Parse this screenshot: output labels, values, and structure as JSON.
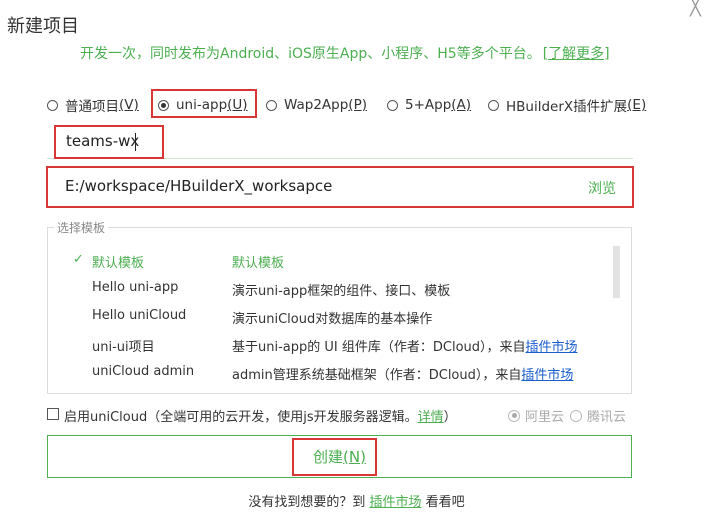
{
  "dialog": {
    "title": "新建项目",
    "close_glyph": "╳"
  },
  "subtitle": {
    "text": "开发一次，同时发布为Android、iOS原生App、小程序、H5等多个平台。",
    "link": "[了解更多]"
  },
  "project_types": [
    {
      "label": "普通项目",
      "hotkey": "(V)",
      "selected": false
    },
    {
      "label": "uni-app",
      "hotkey": "(U)",
      "selected": true
    },
    {
      "label": "Wap2App",
      "hotkey": "(P)",
      "selected": false
    },
    {
      "label": "5+App",
      "hotkey": "(A)",
      "selected": false
    },
    {
      "label": "HBuilderX插件扩展",
      "hotkey": "(E)",
      "selected": false
    }
  ],
  "project_name": {
    "value": "teams-wx"
  },
  "project_path": {
    "value": "E:/workspace/HBuilderX_worksapce",
    "browse_label": "浏览"
  },
  "templates": {
    "legend": "选择模板",
    "rows": [
      {
        "name": "默认模板",
        "desc": "默认模板",
        "link": "",
        "selected": true
      },
      {
        "name": "Hello uni-app",
        "desc": "演示uni-app框架的组件、接口、模板",
        "link": "",
        "selected": false
      },
      {
        "name": "Hello uniCloud",
        "desc": "演示uniCloud对数据库的基本操作",
        "link": "",
        "selected": false
      },
      {
        "name": "uni-ui项目",
        "desc": "基于uni-app的 UI 组件库（作者：DCloud），来自",
        "link": "插件市场",
        "selected": false
      },
      {
        "name": "uniCloud admin",
        "desc": "admin管理系统基础框架（作者：DCloud），来自",
        "link": "插件市场",
        "selected": false
      }
    ]
  },
  "unicloud": {
    "label": "启用uniCloud（全端可用的云开发，使用js开发服务器逻辑。",
    "detail_link": "详情",
    "label_end": "）",
    "providers": [
      {
        "label": "阿里云",
        "selected": true
      },
      {
        "label": "腾讯云",
        "selected": false
      }
    ]
  },
  "create_button": {
    "label": "创建",
    "hotkey": "(N)"
  },
  "footer": {
    "text": "没有找到想要的？到",
    "link": "插件市场",
    "text_end": "看看吧"
  },
  "colors": {
    "accent": "#4caf50",
    "highlight": "#d93636",
    "link": "#1a5ecc"
  }
}
